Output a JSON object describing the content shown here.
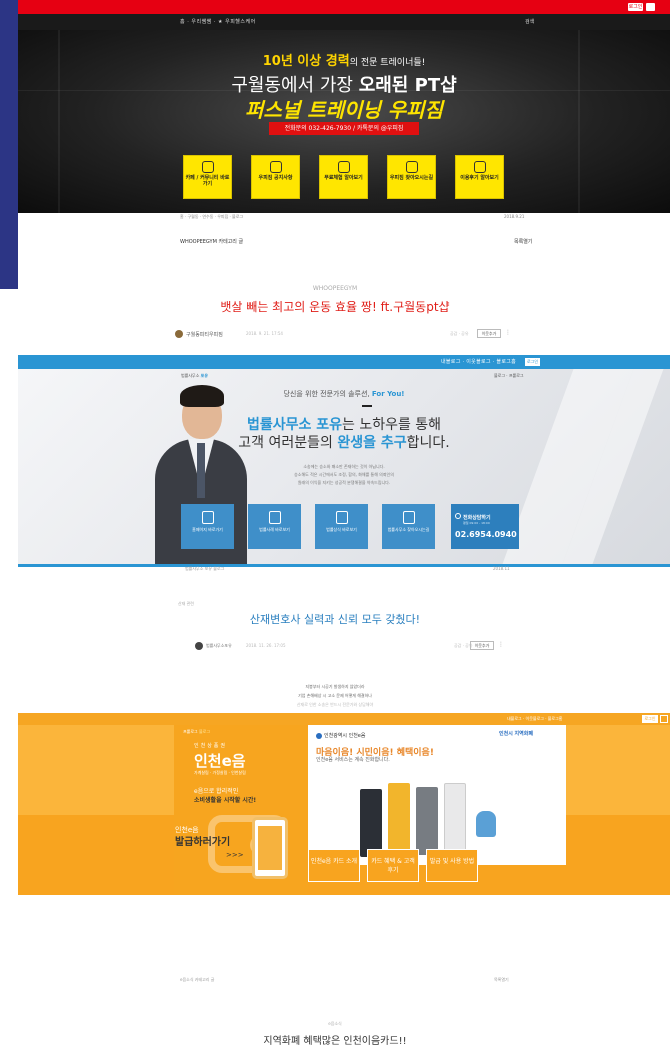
{
  "gym": {
    "top_btn1": "로그인",
    "top_btn2": "",
    "nav_menu": "홈 · 우리쌤쌤 · ★ 우피헬스케어",
    "nav_right": "검색",
    "hero_sub_hl": "10년 이상 경력",
    "hero_sub_rest": "의 전문 트레이너들!",
    "hero_title1_a": "구월동에서 가장 ",
    "hero_title1_b": "오래된 PT샵",
    "hero_title2": "퍼스널 트레이닝 우피짐",
    "hero_phone": "전화문의 032-426-7930 / 카톡문의 @우피짐",
    "buttons": [
      {
        "label": "카페 / 커뮤니티 바로가기"
      },
      {
        "label": "우피짐 공지사항"
      },
      {
        "label": "무료체험 알아보기"
      },
      {
        "label": "우피짐 찾아오시는길"
      },
      {
        "label": "이용후기 알아보기"
      }
    ],
    "breadcrumb": "홈 · 구월동 · 연수동 · 우피짐 · 블로그",
    "date_right": "2018.9.21",
    "category": "WHOOPEEGYM 카테고리 글",
    "list_label": "목록열기",
    "brand": "WHOOPEEGYM",
    "post_title": "뱃살 빼는 최고의 운동 효율 짱! ft.구월동pt샵",
    "author": "구월동피티우피짐",
    "post_date": "2018. 9. 21. 17:54",
    "views": "공감 · 공유",
    "neighbor_btn": "이웃추가",
    "more": "⋮"
  },
  "law": {
    "top_menu": "내블로그 · 이웃블로그 · 블로그홈",
    "top_btn": "로그인",
    "logo_prefix": "법률사무소 ",
    "logo_bold": "포유",
    "top_links": "블로그 · 프롤로그",
    "tag_a": "당신을 위한 전문가의 솔루션, ",
    "tag_b": "For You!",
    "h1_b": "법률사무소 포유",
    "h1_rest": "는 노하우를 통해",
    "h2_a": "고객 여러분들의 ",
    "h2_b": "완생을 추구",
    "h2_c": "합니다.",
    "small1": "소송에는 승소와 패소만 존재하는 것이 아닙니다.",
    "small2": "승소해도 적은 시간에서도 조정, 합의, 화해를 통해 의뢰인의",
    "small3": "원래의 이익을 지키는 성공적 분쟁해결을 약속드립니다.",
    "buttons": [
      {
        "label": "홈페이지 바로가기"
      },
      {
        "label": "법률사례 바로보기"
      },
      {
        "label": "법률상식 바로보기"
      },
      {
        "label": "법률사무소 찾아오시는길"
      }
    ],
    "phone_title": "전화상담하기",
    "phone_hours": "평일 09:00 - 18:00",
    "phone_number": "02.6954.0940",
    "breadcrumb": "법률사무소 포유 블로그",
    "date_right": "2018.11",
    "category": "산재 관련",
    "post_title": "산재변호사 실력과 신뢰 모두 갖췄다!",
    "author": "법률사무소포유",
    "post_date": "2018. 11. 26. 17:05",
    "views": "공감 · 공유",
    "neighbor_btn": "이웃추가",
    "more": "⋮",
    "body1": "지붕부터 시공기 발생하지 않았더라",
    "body2": "기업 손해배상 시 고소 문제 어떻게 해결하나",
    "body3": "산재로 인한 소송은 반드시 전문가와 상담해야"
  },
  "incheon": {
    "top_menu": "내블로그 · 이웃블로그 · 블로그홈",
    "top_btn": "로그인",
    "tag_a": "프롤로그 ",
    "tag_b": "블로그",
    "left_sub": "인천상품권",
    "logo": "인천e음",
    "logoline": "가계살림 · 가정살림 · 인천살림",
    "left_txt1": "e음으로 합리적인",
    "left_txt2": "소비생활을 시작할 시간!",
    "go1": "인천e음",
    "go2": "발급하러가기",
    "go3": ">>>",
    "brand": "인천광역시 인천e음",
    "right_logo": "인천시 지역화폐",
    "h1": "마음이음! 시민이음! 혜택이음!",
    "h2": "인천e음 서비스는 계속 진화합니다.",
    "buttons": [
      {
        "label": "인천e음 카드 소개"
      },
      {
        "label": "카드 혜택 & 고객 후기"
      },
      {
        "label": "발급 및 사용 방법"
      }
    ],
    "category": "e음소식 카테고리 글",
    "list_label": "목록열기",
    "small": "e음소식",
    "post_title": "지역화폐 혜택많은 인천이음카드!!"
  }
}
